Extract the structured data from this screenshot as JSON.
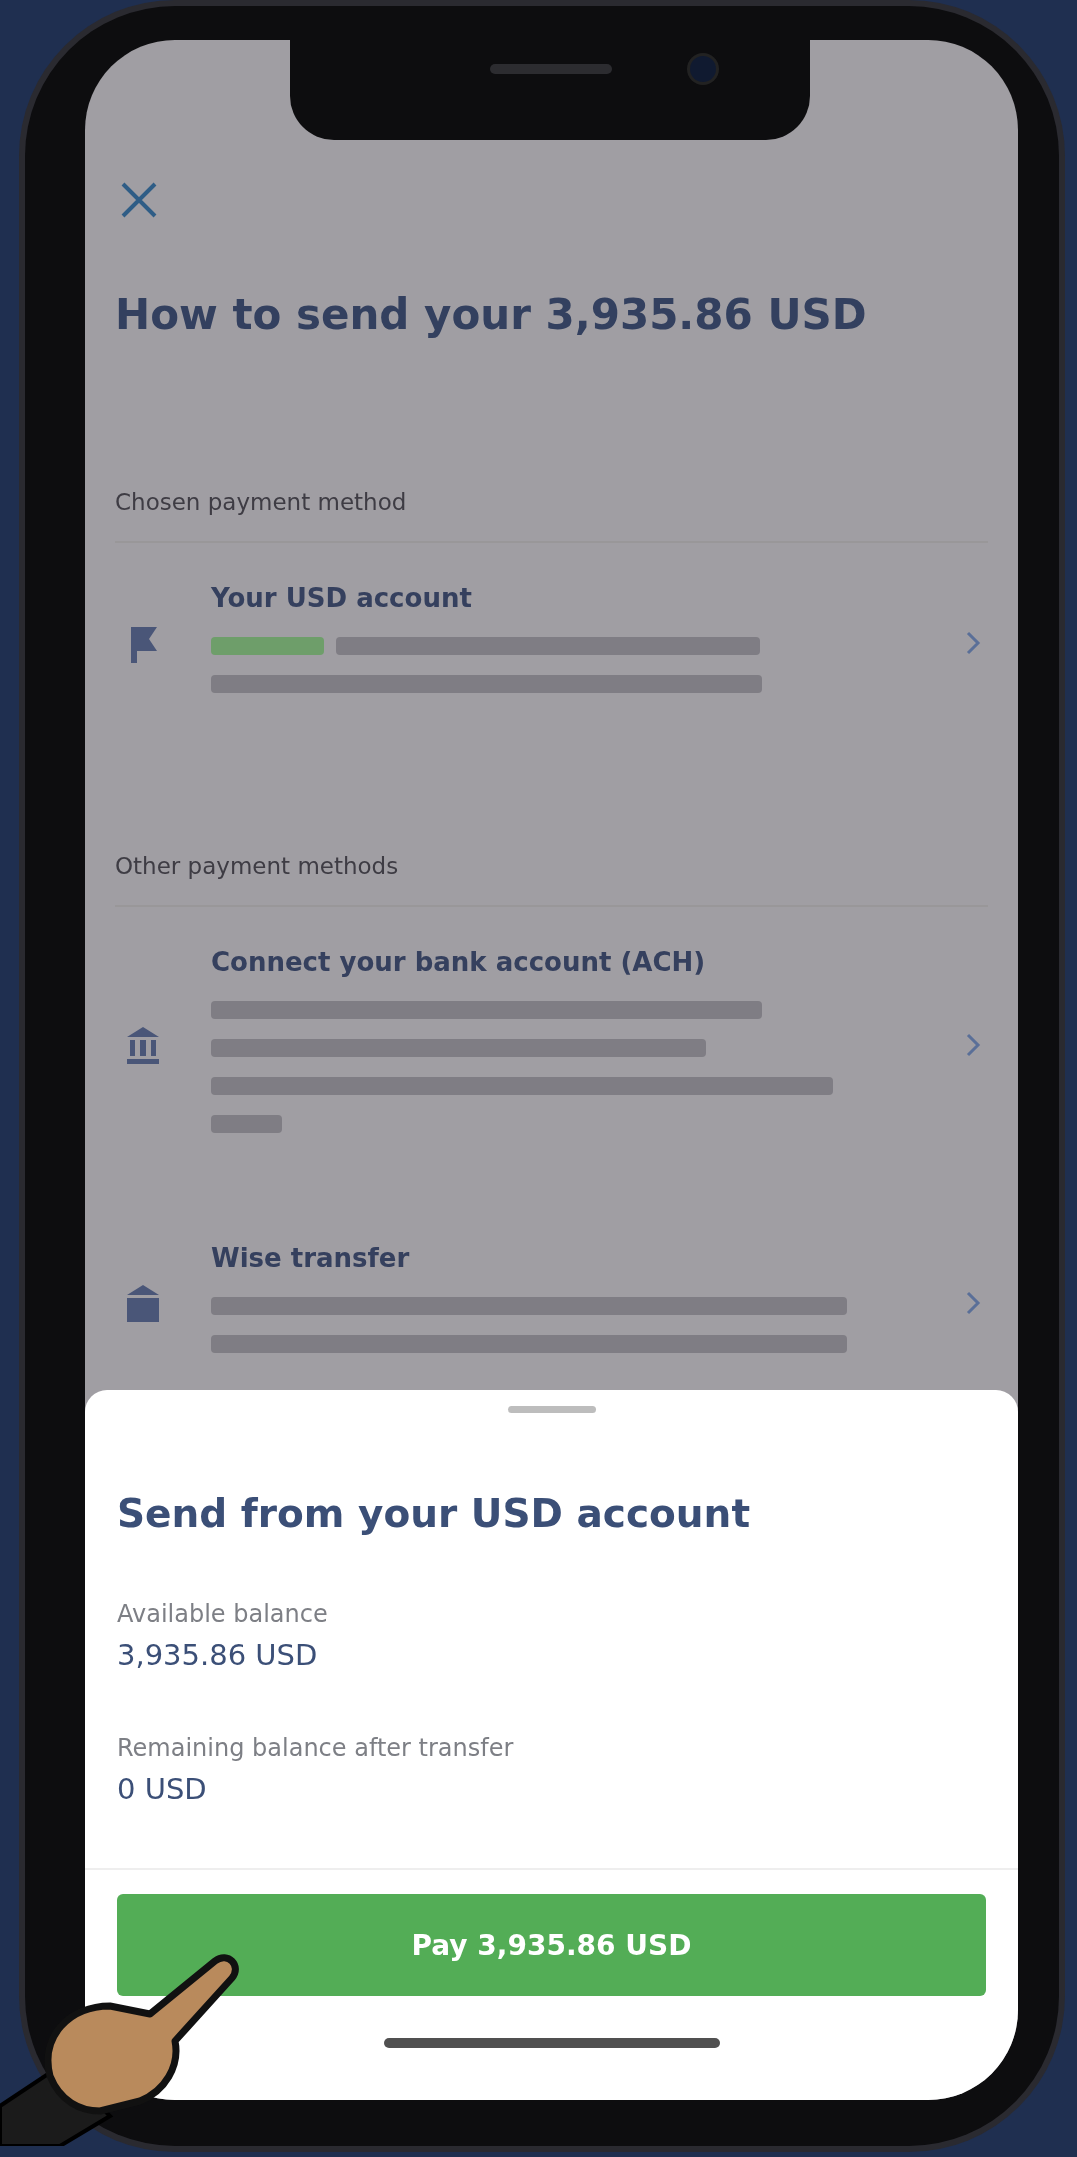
{
  "screen": {
    "title": "How to send your 3,935.86 USD",
    "sections": [
      {
        "heading": "Chosen payment method",
        "methods": [
          {
            "title": "Your USD account",
            "kind": "balance"
          }
        ]
      },
      {
        "heading": "Other payment methods",
        "methods": [
          {
            "title": "Connect your bank account (ACH)",
            "kind": "bank"
          },
          {
            "title": "Wise transfer",
            "kind": "transfer"
          }
        ]
      }
    ]
  },
  "sheet": {
    "title": "Send from your USD account",
    "rows": [
      {
        "label": "Available balance",
        "value": "3,935.86 USD"
      },
      {
        "label": "Remaining balance after transfer",
        "value": "0 USD"
      }
    ],
    "button": "Pay 3,935.86 USD"
  }
}
